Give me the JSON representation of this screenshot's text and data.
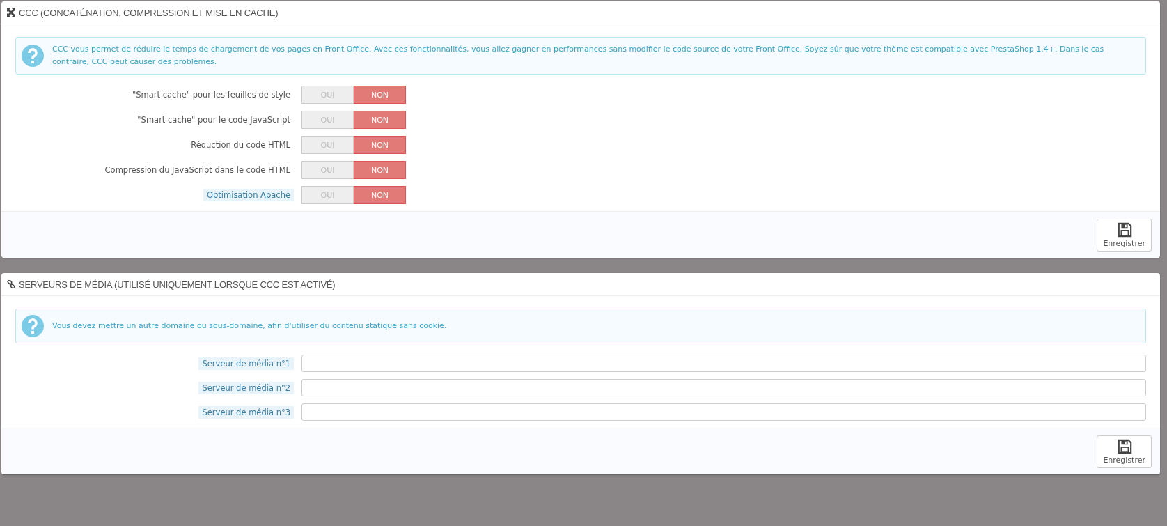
{
  "panels": [
    {
      "kind": "toggles",
      "title": "CCC (CONCATÉNATION, COMPRESSION ET MISE EN CACHE)",
      "info": "CCC vous permet de réduire le temps de chargement de vos pages en Front Office. Avec ces fonctionnalités, vous allez gagner en performances sans modifier le code source de votre Front Office. Soyez sûr que votre thème est compatible avec PrestaShop 1.4+. Dans le cas contraire, CCC peut causer des problèmes.",
      "fields": [
        {
          "label": "\"Smart cache\" pour les feuilles de style",
          "hint": false,
          "yes": "OUI",
          "no": "NON",
          "on": false
        },
        {
          "label": "\"Smart cache\" pour le code JavaScript",
          "hint": false,
          "yes": "OUI",
          "no": "NON",
          "on": false
        },
        {
          "label": "Réduction du code HTML",
          "hint": false,
          "yes": "OUI",
          "no": "NON",
          "on": false
        },
        {
          "label": "Compression du JavaScript dans le code HTML",
          "hint": false,
          "yes": "OUI",
          "no": "NON",
          "on": false
        },
        {
          "label": "Optimisation Apache",
          "hint": true,
          "yes": "OUI",
          "no": "NON",
          "on": false
        }
      ],
      "save": "Enregistrer"
    },
    {
      "kind": "inputs",
      "title": "SERVEURS DE MÉDIA (UTILISÉ UNIQUEMENT LORSQUE CCC EST ACTIVÉ)",
      "info": "Vous devez mettre un autre domaine ou sous-domaine, afin d'utiliser du contenu statique sans cookie.",
      "fields": [
        {
          "label": "Serveur de média n°1",
          "hint": true
        },
        {
          "label": "Serveur de média n°2",
          "hint": true
        },
        {
          "label": "Serveur de média n°3",
          "hint": true
        }
      ],
      "save": "Enregistrer"
    }
  ]
}
